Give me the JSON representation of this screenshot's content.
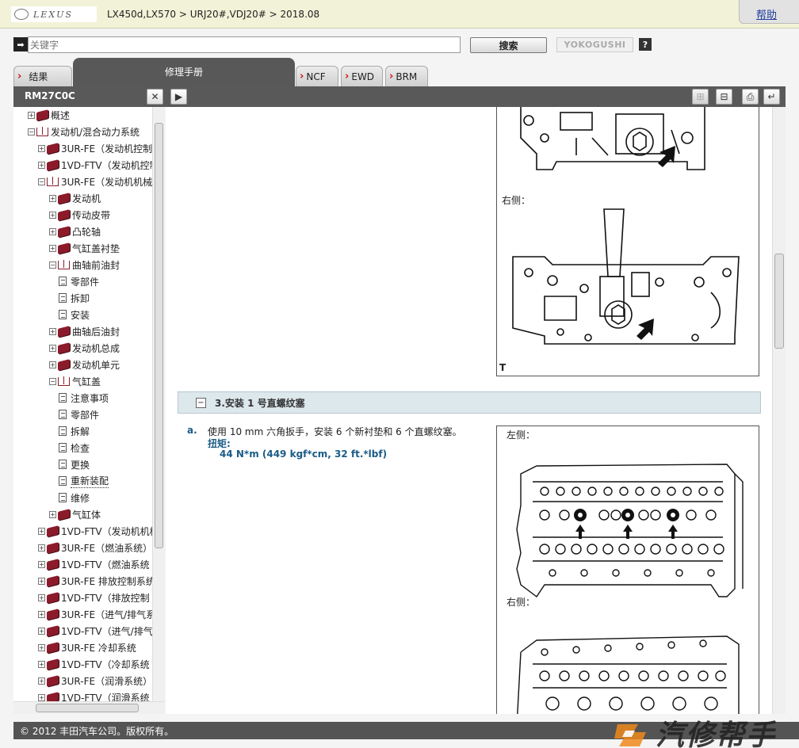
{
  "header": {
    "logo_text": "LEXUS",
    "breadcrumb": "LX450d,LX570 > URJ20#,VDJ20# > 2018.08",
    "help_label": "帮助"
  },
  "search": {
    "placeholder": "关键字",
    "search_label": "搜索",
    "yokogushi_label": "YOKOGUSHI",
    "question_label": "?"
  },
  "tabs": [
    {
      "label": "结果"
    },
    {
      "label": "修理手册"
    },
    {
      "label": "NCF"
    },
    {
      "label": "EWD"
    },
    {
      "label": "BRM"
    }
  ],
  "toolbar": {
    "doc_code": "RM27C0C",
    "close_glyph": "✕",
    "play_glyph": "▶",
    "expand_glyph": "⊞",
    "collapse_glyph": "⊟",
    "print_glyph": "⎙",
    "return_glyph": "↵"
  },
  "tree": [
    {
      "label": "概述",
      "level": 1,
      "icon": "book-closed",
      "pm": "+"
    },
    {
      "label": "发动机/混合动力系统",
      "level": 1,
      "icon": "book-open",
      "pm": "-"
    },
    {
      "label": "3UR-FE（发动机控制",
      "level": 2,
      "icon": "book-closed",
      "pm": "+"
    },
    {
      "label": "1VD-FTV（发动机控制",
      "level": 2,
      "icon": "book-closed",
      "pm": "+"
    },
    {
      "label": "3UR-FE（发动机机械",
      "level": 2,
      "icon": "book-open",
      "pm": "-"
    },
    {
      "label": "发动机",
      "level": 3,
      "icon": "book-closed",
      "pm": "+"
    },
    {
      "label": "传动皮带",
      "level": 3,
      "icon": "book-closed",
      "pm": "+"
    },
    {
      "label": "凸轮轴",
      "level": 3,
      "icon": "book-closed",
      "pm": "+"
    },
    {
      "label": "气缸盖衬垫",
      "level": 3,
      "icon": "book-closed",
      "pm": "+"
    },
    {
      "label": "曲轴前油封",
      "level": 3,
      "icon": "book-open",
      "pm": "-"
    },
    {
      "label": "零部件",
      "level": 4,
      "icon": "page"
    },
    {
      "label": "拆卸",
      "level": 4,
      "icon": "page"
    },
    {
      "label": "安装",
      "level": 4,
      "icon": "page"
    },
    {
      "label": "曲轴后油封",
      "level": 3,
      "icon": "book-closed",
      "pm": "+"
    },
    {
      "label": "发动机总成",
      "level": 3,
      "icon": "book-closed",
      "pm": "+"
    },
    {
      "label": "发动机单元",
      "level": 3,
      "icon": "book-closed",
      "pm": "+"
    },
    {
      "label": "气缸盖",
      "level": 3,
      "icon": "book-open",
      "pm": "-"
    },
    {
      "label": "注意事项",
      "level": 4,
      "icon": "page"
    },
    {
      "label": "零部件",
      "level": 4,
      "icon": "page"
    },
    {
      "label": "拆解",
      "level": 4,
      "icon": "page"
    },
    {
      "label": "检查",
      "level": 4,
      "icon": "page"
    },
    {
      "label": "更换",
      "level": 4,
      "icon": "page"
    },
    {
      "label": "重新装配",
      "level": 4,
      "icon": "page",
      "selected": true
    },
    {
      "label": "维修",
      "level": 4,
      "icon": "page"
    },
    {
      "label": "气缸体",
      "level": 3,
      "icon": "book-closed",
      "pm": "+"
    },
    {
      "label": "1VD-FTV（发动机机械",
      "level": 2,
      "icon": "book-closed",
      "pm": "+"
    },
    {
      "label": "3UR-FE（燃油系统）",
      "level": 2,
      "icon": "book-closed",
      "pm": "+"
    },
    {
      "label": "1VD-FTV（燃油系统",
      "level": 2,
      "icon": "book-closed",
      "pm": "+"
    },
    {
      "label": "3UR-FE 排放控制系统",
      "level": 2,
      "icon": "book-closed",
      "pm": "+"
    },
    {
      "label": "1VD-FTV（排放控制",
      "level": 2,
      "icon": "book-closed",
      "pm": "+"
    },
    {
      "label": "3UR-FE（进气/排气系",
      "level": 2,
      "icon": "book-closed",
      "pm": "+"
    },
    {
      "label": "1VD-FTV（进气/排气",
      "level": 2,
      "icon": "book-closed",
      "pm": "+"
    },
    {
      "label": "3UR-FE 冷却系统",
      "level": 2,
      "icon": "book-closed",
      "pm": "+"
    },
    {
      "label": "1VD-FTV（冷却系统",
      "level": 2,
      "icon": "book-closed",
      "pm": "+"
    },
    {
      "label": "3UR-FE（润滑系统）",
      "level": 2,
      "icon": "book-closed",
      "pm": "+"
    },
    {
      "label": "1VD-FTV（润滑系统",
      "level": 2,
      "icon": "book-closed",
      "pm": "+"
    }
  ],
  "content": {
    "fig1_right_label": "右侧：",
    "fig1_corner_mark": "T",
    "step_title": "3.安装 1 号直螺纹塞",
    "step_a_letter": "a.",
    "step_a_text": "使用 10 mm 六角扳手，安装 6 个新衬垫和 6 个直螺纹塞。",
    "torque_label": "扭矩:",
    "torque_value": "44 N*m (449 kgf*cm, 32 ft.*lbf)",
    "fig2_left_label": "左侧：",
    "fig2_right_label": "右侧："
  },
  "footer": {
    "copyright": "© 2012 丰田汽车公司。版权所有。"
  },
  "watermark": {
    "text": "汽修帮手"
  },
  "colors": {
    "accent_red": "#c81818",
    "link_blue": "#1d3c9e",
    "torque_blue": "#1a5c86",
    "toolbar_gray": "#595959"
  }
}
